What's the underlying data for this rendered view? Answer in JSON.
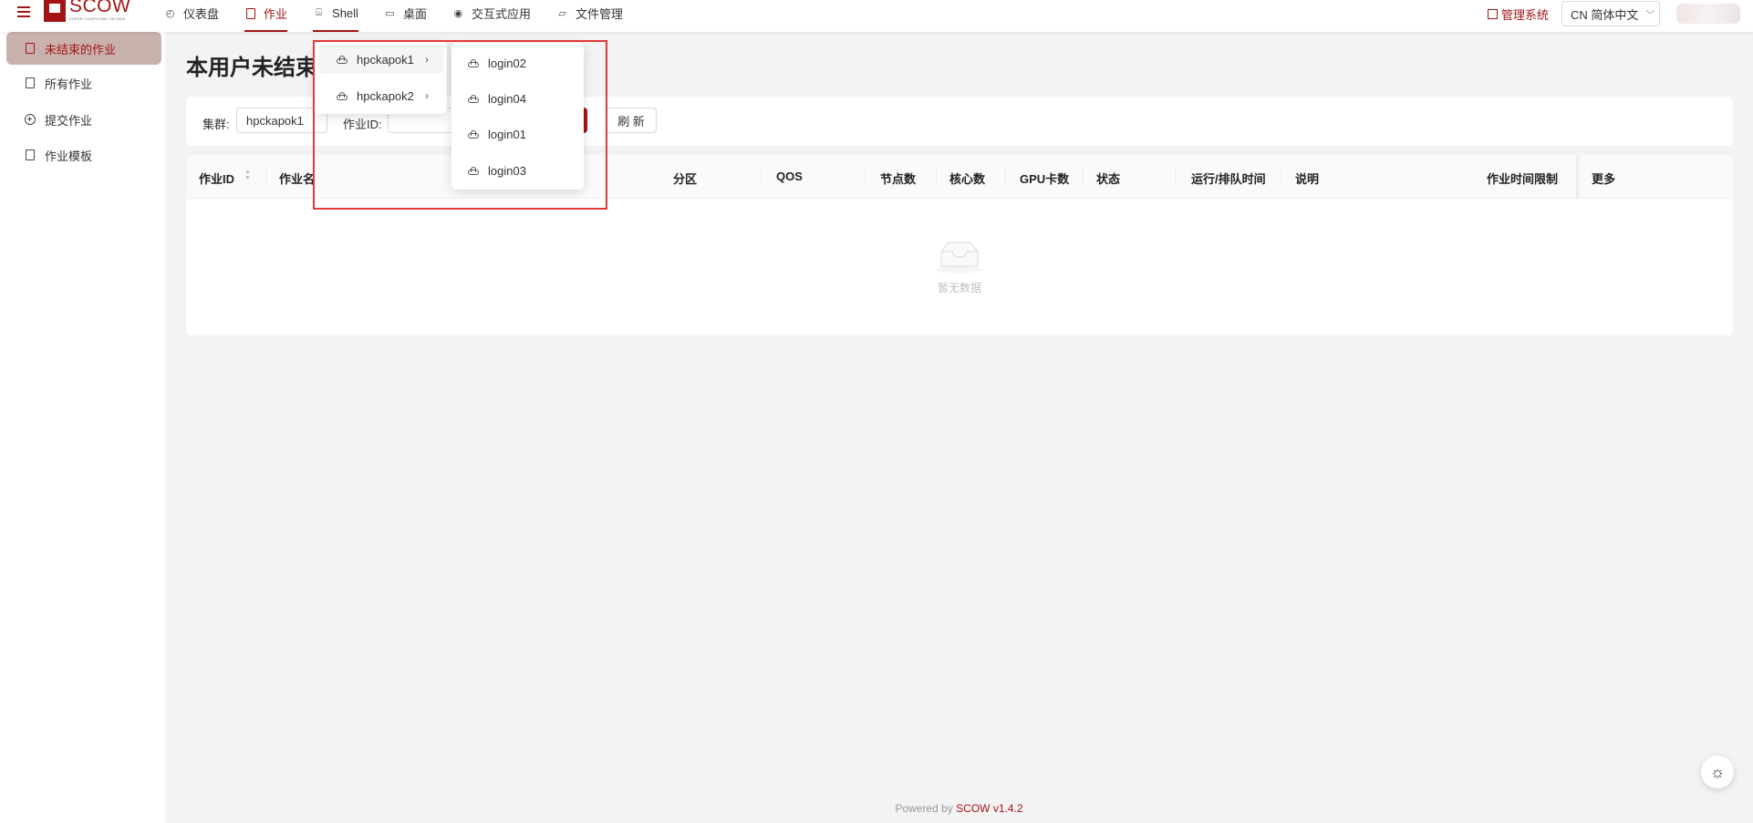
{
  "header": {
    "logo": {
      "name": "SCOW",
      "tagline": "SUPER COMPUTING ON WEB"
    },
    "nav": [
      {
        "label": "仪表盘",
        "icon": "dashboard-icon"
      },
      {
        "label": "作业",
        "icon": "file-icon"
      },
      {
        "label": "Shell",
        "icon": "terminal-icon"
      },
      {
        "label": "桌面",
        "icon": "desktop-icon"
      },
      {
        "label": "交互式应用",
        "icon": "eye-icon"
      },
      {
        "label": "文件管理",
        "icon": "folder-icon"
      }
    ],
    "management_link": "管理系统",
    "language": "CN 简体中文"
  },
  "sidebar": {
    "items": [
      {
        "label": "未结束的作业",
        "active": true
      },
      {
        "label": "所有作业"
      },
      {
        "label": "提交作业"
      },
      {
        "label": "作业模板"
      }
    ]
  },
  "page": {
    "title": "本用户未结束的作业",
    "filters": {
      "cluster_label": "集群:",
      "cluster_value": "hpckapok1",
      "job_id_label": "作业ID:",
      "refresh_label": "刷 新"
    }
  },
  "table": {
    "columns": [
      "作业ID",
      "作业名",
      "分区",
      "QOS",
      "节点数",
      "核心数",
      "GPU卡数",
      "状态",
      "运行/排队时间",
      "说明",
      "作业时间限制",
      "更多"
    ],
    "empty_text": "暂无数据"
  },
  "dropdown": {
    "clusters": [
      "hpckapok1",
      "hpckapok2"
    ],
    "login_nodes": [
      "login02",
      "login04",
      "login01",
      "login03"
    ]
  },
  "footer": {
    "prefix": "Powered by ",
    "brand": "SCOW v1.4.2"
  },
  "colors": {
    "accent": "#a31515",
    "highlight_box": "#e43a3a",
    "sidebar_active_bg": "#c9b1ad"
  }
}
